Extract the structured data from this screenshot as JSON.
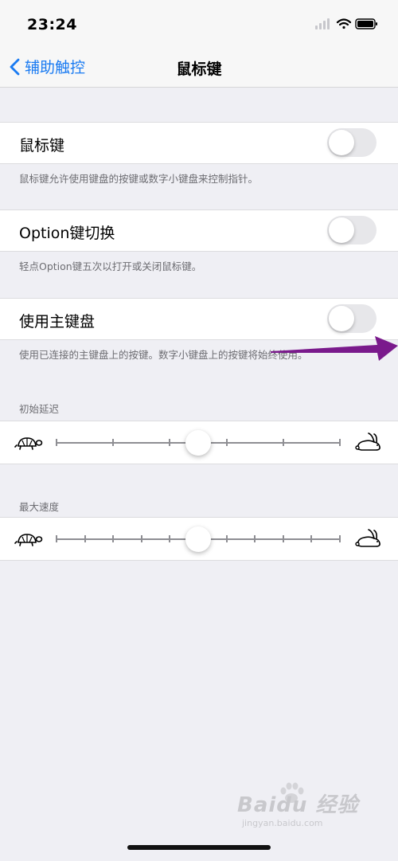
{
  "status_bar": {
    "time": "23:24"
  },
  "nav": {
    "back_label": "辅助触控",
    "title": "鼠标键"
  },
  "mouse_keys": {
    "label": "鼠标键",
    "on": false,
    "footer": "鼠标键允许使用键盘的按键或数字小键盘来控制指针。"
  },
  "option_toggle": {
    "label": "Option键切换",
    "on": false,
    "footer": "轻点Option键五次以打开或关闭鼠标键。"
  },
  "main_keyboard": {
    "label": "使用主键盘",
    "on": false,
    "footer": "使用已连接的主键盘上的按键。数字小键盘上的按键将始终使用。"
  },
  "initial_delay": {
    "header": "初始延迟",
    "steps": 5,
    "value_fraction": 0.5
  },
  "max_speed": {
    "header": "最大速度",
    "steps": 10,
    "value_fraction": 0.5
  },
  "watermark": {
    "brand": "Baidu 经验",
    "url": "jingyan.baidu.com"
  },
  "colors": {
    "accent": "#1a7bf2",
    "annotation_arrow": "#7a1a8c",
    "background": "#efeff4"
  },
  "icons": [
    "chevron-left-icon",
    "signal-icon",
    "wifi-icon",
    "battery-icon",
    "turtle-icon",
    "rabbit-icon"
  ]
}
